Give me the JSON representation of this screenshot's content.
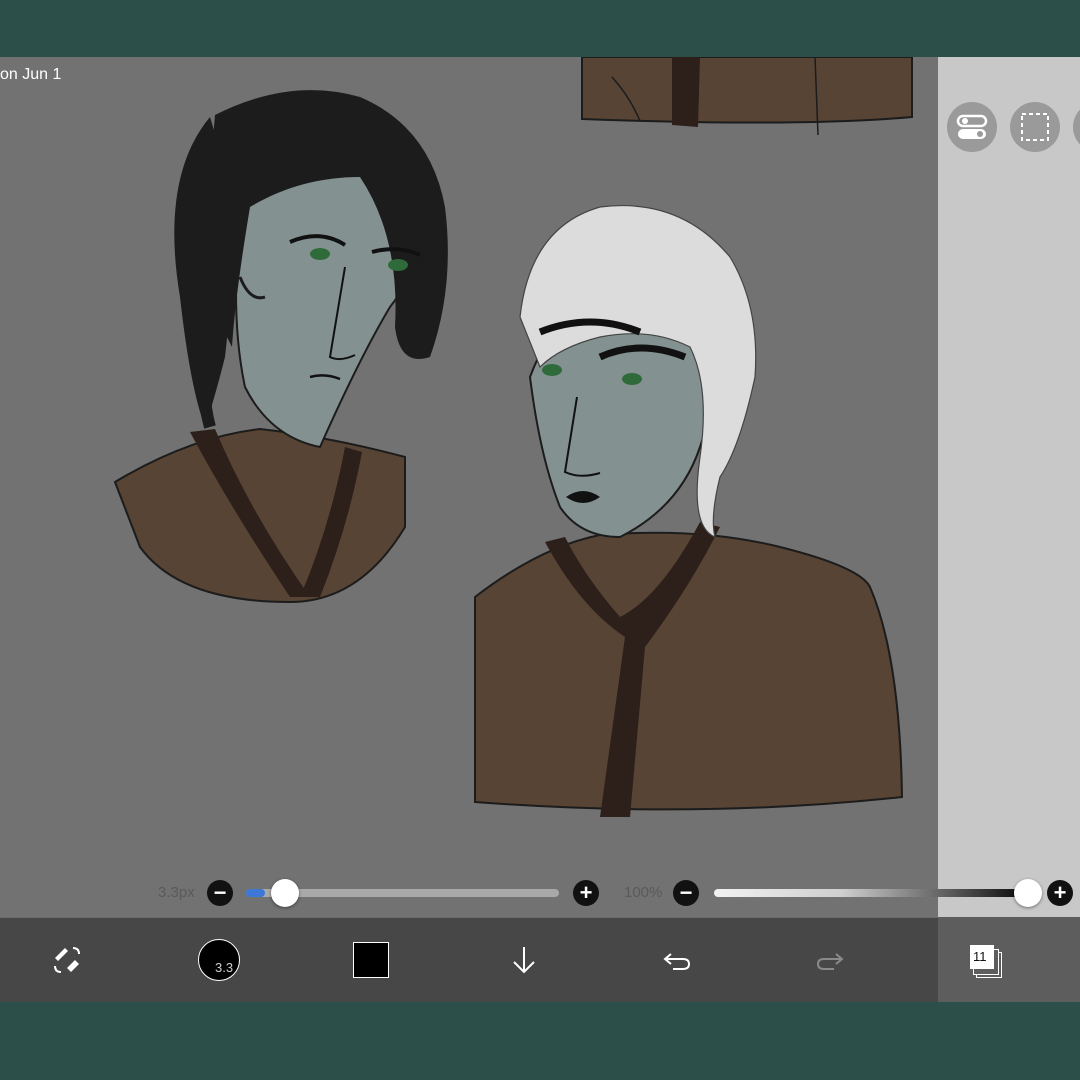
{
  "canvas": {
    "date_label": "on Jun 1",
    "background": "#727272"
  },
  "brush_size": {
    "label": "3.3px",
    "value": 3.3,
    "fraction": 0.06
  },
  "opacity": {
    "label": "100%",
    "value": 100
  },
  "toolbar": {
    "brush_preview_label": "3.3",
    "color": "#000000",
    "layers_count": "11"
  },
  "icons": {
    "tool_switch": "brush-eraser-swap-icon",
    "toggle": "toggle-switch-icon",
    "selection": "dashed-selection-icon",
    "move_down": "arrow-down-icon",
    "undo": "undo-icon",
    "redo": "redo-icon",
    "layers": "layers-icon"
  },
  "colors": {
    "frame": "#2d4f4a",
    "skin": "#849191",
    "robe": "#574434",
    "robe_trim": "#2d1f1a",
    "dark_hair": "#1c1c1c",
    "light_hair": "#dcdcdc",
    "eye": "#2f6b3a"
  }
}
